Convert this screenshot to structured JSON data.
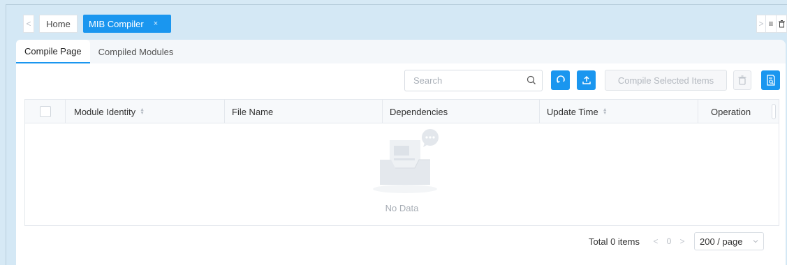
{
  "tabs": {
    "prev_arrow": "<",
    "next_arrow": ">",
    "home_label": "Home",
    "active_label": "MIB Compiler",
    "close_glyph": "×",
    "menu_glyph": "≡",
    "trash_glyph": "trash-icon"
  },
  "subtabs": [
    {
      "label": "Compile Page",
      "active": true
    },
    {
      "label": "Compiled Modules",
      "active": false
    }
  ],
  "toolbar": {
    "search_placeholder": "Search",
    "compile_label": "Compile Selected Items"
  },
  "table": {
    "columns": [
      "Module Identity",
      "File Name",
      "Dependencies",
      "Update Time",
      "Operation"
    ],
    "empty_text": "No Data"
  },
  "pagination": {
    "total_label": "Total 0 items",
    "current_page": "0",
    "page_size": "200 / page"
  },
  "colors": {
    "accent": "#1a96ef",
    "background": "#d4e8f5"
  }
}
